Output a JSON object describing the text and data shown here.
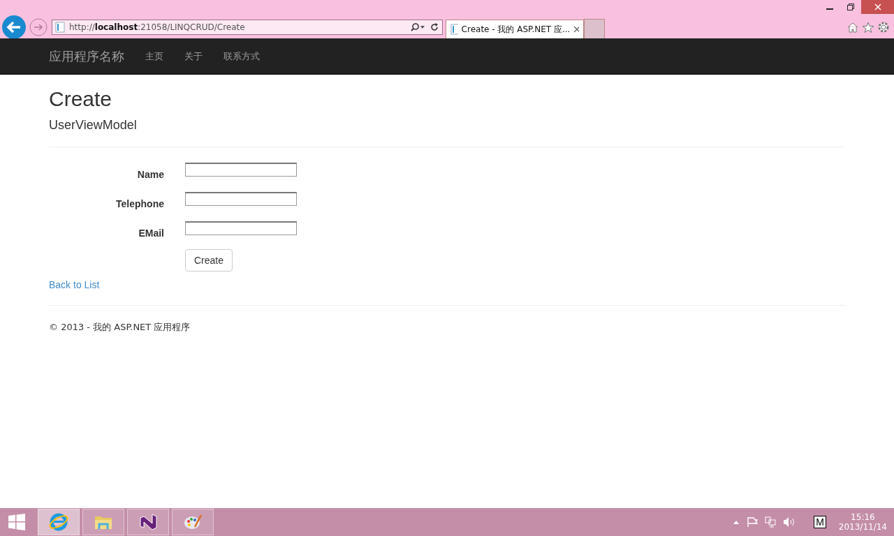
{
  "browser": {
    "address": "http://**localhost**:21058/LINQCRUD/Create",
    "tabs": [
      {
        "label": "Create - 我的 ASP.NET 应...",
        "selected": true
      }
    ]
  },
  "navbar": {
    "brand": "应用程序名称",
    "links": [
      "主页",
      "关于",
      "联系方式"
    ]
  },
  "page": {
    "title": "Create",
    "subtitle": "UserViewModel",
    "fields": [
      {
        "label": "Name"
      },
      {
        "label": "Telephone"
      },
      {
        "label": "EMail"
      }
    ],
    "submit": "Create",
    "back_link": "Back to List",
    "footer": "© 2013 - 我的 ASP.NET 应用程序"
  },
  "taskbar": {
    "apps": [
      {
        "kind": "ie",
        "selected": true
      },
      {
        "kind": "folder",
        "selected": false
      },
      {
        "kind": "vs",
        "selected": false
      },
      {
        "kind": "paint",
        "selected": false
      }
    ],
    "ime": "M",
    "time": "15:16",
    "date": "2013/11/14"
  }
}
